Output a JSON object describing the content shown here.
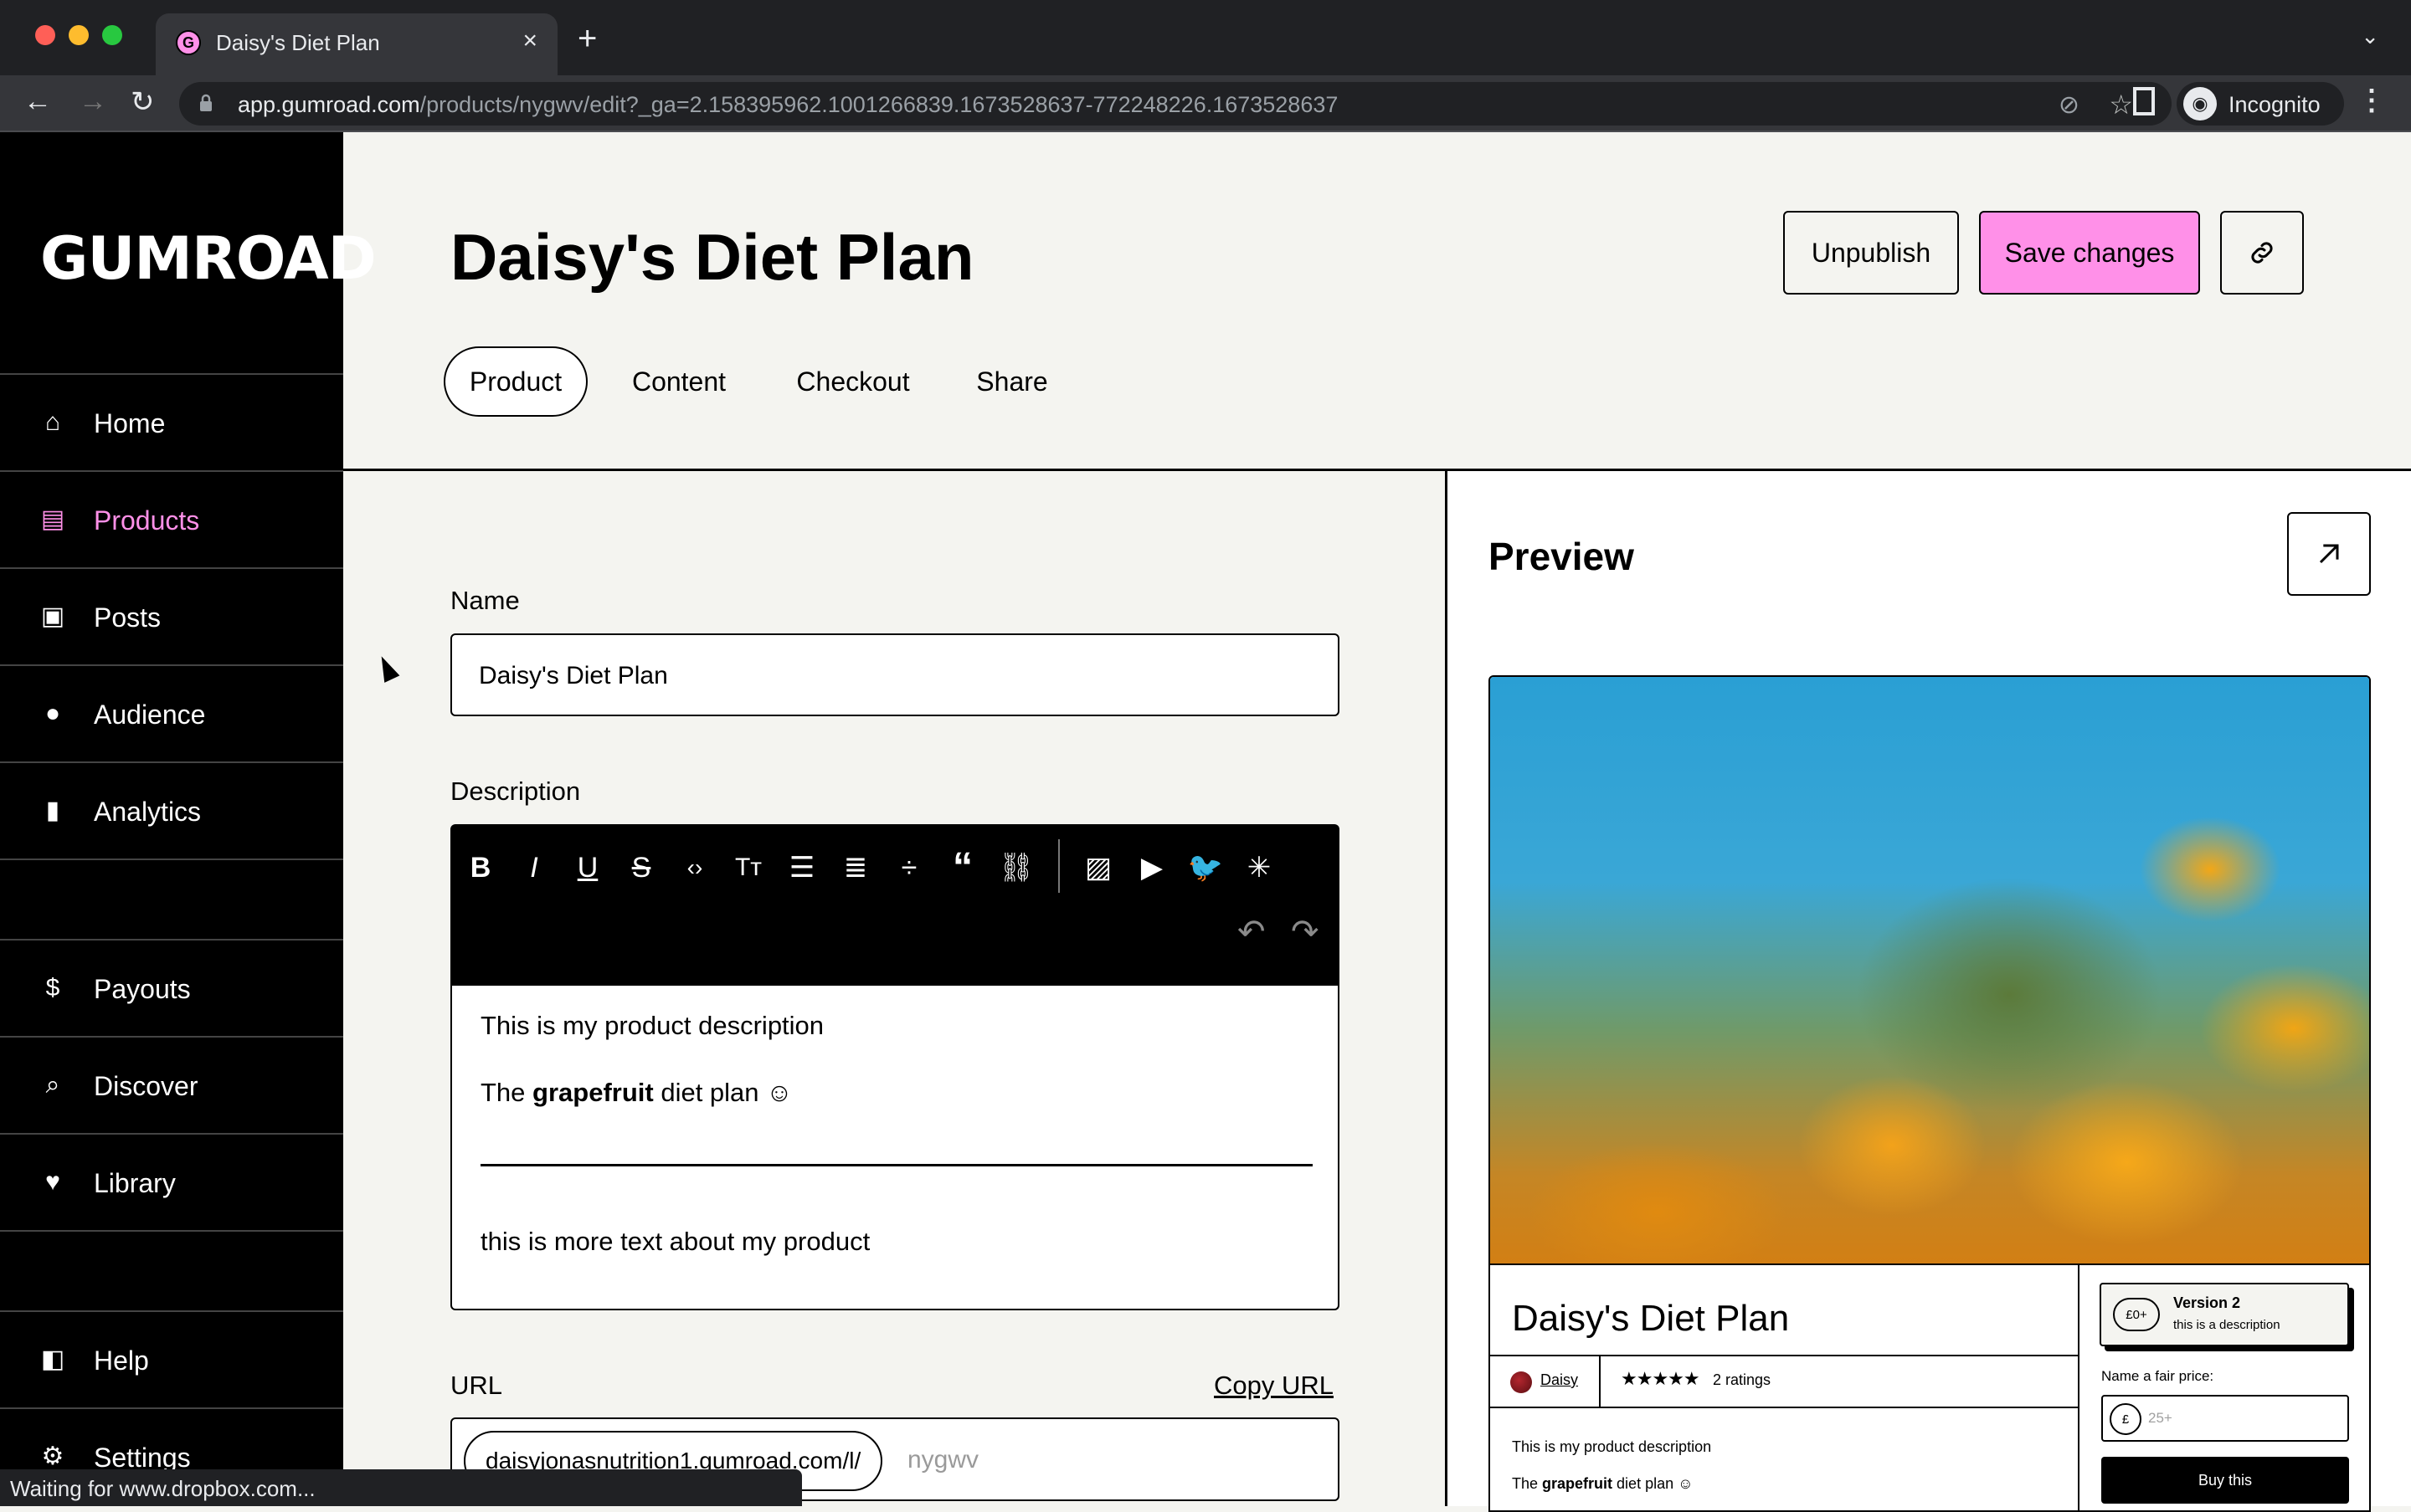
{
  "browser": {
    "tab_title": "Daisy's Diet Plan",
    "tab_favicon": "G",
    "url_host": "app.gumroad.com",
    "url_path": "/products/nygwv/edit?_ga=2.158395962.1001266839.1673528637-772248226.1673528637",
    "profile_label": "Incognito",
    "status_text": "Waiting for www.dropbox.com..."
  },
  "sidebar": {
    "logo": "GUMROAD",
    "items": [
      {
        "label": "Home",
        "icon": "store-icon",
        "active": false
      },
      {
        "label": "Products",
        "icon": "archive-box-icon",
        "active": true
      },
      {
        "label": "Posts",
        "icon": "document-icon",
        "active": false
      },
      {
        "label": "Audience",
        "icon": "people-icon",
        "active": false
      },
      {
        "label": "Analytics",
        "icon": "bar-chart-icon",
        "active": false
      },
      {
        "label": "Payouts",
        "icon": "dollar-circle-icon",
        "active": false
      },
      {
        "label": "Discover",
        "icon": "search-icon",
        "active": false
      },
      {
        "label": "Library",
        "icon": "bookmark-heart-icon",
        "active": false
      },
      {
        "label": "Help",
        "icon": "book-icon",
        "active": false
      },
      {
        "label": "Settings",
        "icon": "gear-icon",
        "active": false
      }
    ]
  },
  "header": {
    "title": "Daisy's Diet Plan",
    "unpublish_label": "Unpublish",
    "save_label": "Save changes",
    "tabs": [
      {
        "label": "Product",
        "active": true
      },
      {
        "label": "Content",
        "active": false
      },
      {
        "label": "Checkout",
        "active": false
      },
      {
        "label": "Share",
        "active": false
      }
    ]
  },
  "form": {
    "name_label": "Name",
    "name_value": "Daisy's Diet Plan",
    "description_label": "Description",
    "toolbar": [
      "bold",
      "italic",
      "underline",
      "strikethrough",
      "code",
      "text-size",
      "bullet-list",
      "numbered-list",
      "divider",
      "quote",
      "link",
      "image",
      "video",
      "twitter",
      "embed"
    ],
    "description": {
      "line1": "This is my product description",
      "line2_pre": "The ",
      "line2_bold": "grapefruit",
      "line2_post": " diet plan ☺",
      "line3": "this is more text about my product"
    },
    "url_label": "URL",
    "copy_url_label": "Copy URL",
    "url_prefix": "daisyjonasnutrition1.gumroad.com/l/",
    "url_slug_placeholder": "nygwv"
  },
  "preview": {
    "title": "Preview",
    "product_title": "Daisy's Diet Plan",
    "creator_name": "Daisy",
    "stars": "★★★★★",
    "rating_count": "2 ratings",
    "desc_line1": "This is my product description",
    "desc_line2_pre": "The ",
    "desc_line2_bold": "grapefruit",
    "desc_line2_post": " diet plan ☺",
    "version_price": "£0+",
    "version_name": "Version 2",
    "version_desc": "this is a description",
    "fair_price_label": "Name a fair price:",
    "currency_symbol": "£",
    "fair_price_placeholder": "25+",
    "buy_label": "Buy this"
  },
  "colors": {
    "accent_pink": "#ff90e8",
    "background": "#f4f4f0"
  }
}
